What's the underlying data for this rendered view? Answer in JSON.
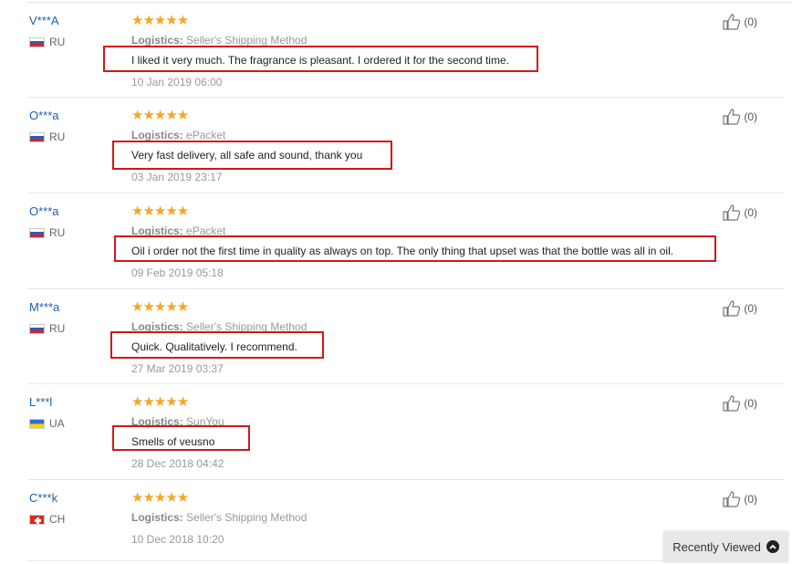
{
  "reviews": [
    {
      "user": "V***A",
      "country": "RU",
      "flag": "ru",
      "stars": "★★★★★",
      "logistics_label": "Logistics:",
      "logistics": "Seller's Shipping Method",
      "text": "I liked it very much. The fragrance is pleasant. I ordered it for the second time.",
      "date": "10 Jan 2019 06:00",
      "likes": "(0)"
    },
    {
      "user": "O***a",
      "country": "RU",
      "flag": "ru",
      "stars": "★★★★★",
      "logistics_label": "Logistics:",
      "logistics": "ePacket",
      "text": "Very fast delivery, all safe and sound, thank you",
      "date": "03 Jan 2019 23:17",
      "likes": "(0)"
    },
    {
      "user": "O***a",
      "country": "RU",
      "flag": "ru",
      "stars": "★★★★★",
      "logistics_label": "Logistics:",
      "logistics": "ePacket",
      "text": "Oil i order not the first time in quality as always on top. The only thing that upset was that the bottle was all in oil.",
      "date": "09 Feb 2019 05:18",
      "likes": "(0)"
    },
    {
      "user": "M***a",
      "country": "RU",
      "flag": "ru",
      "stars": "★★★★★",
      "logistics_label": "Logistics:",
      "logistics": "Seller's Shipping Method",
      "text": "Quick. Qualitatively. I recommend.",
      "date": "27 Mar 2019 03:37",
      "likes": "(0)"
    },
    {
      "user": "L***l",
      "country": "UA",
      "flag": "ua",
      "stars": "★★★★★",
      "logistics_label": "Logistics:",
      "logistics": "SunYou",
      "text": "Smells of veusno",
      "date": "28 Dec 2018 04:42",
      "likes": "(0)"
    },
    {
      "user": "C***k",
      "country": "CH",
      "flag": "ch",
      "stars": "★★★★★",
      "logistics_label": "Logistics:",
      "logistics": "Seller's Shipping Method",
      "text": "",
      "date": "10 Dec 2018 10:20",
      "likes": "(0)"
    }
  ],
  "recently_viewed": {
    "label": "Recently Viewed",
    "icon": "chevron-up-circle-icon"
  },
  "colors": {
    "star": "#f5a623",
    "username": "#1f5fa8",
    "highlight": "#d01818"
  }
}
